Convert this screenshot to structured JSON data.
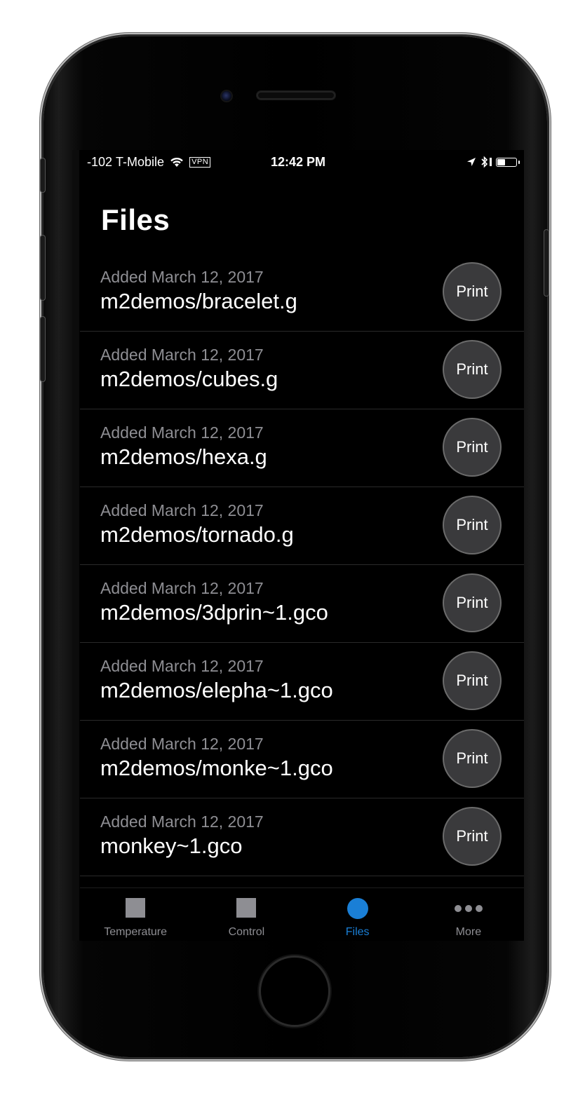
{
  "status_bar": {
    "signal": "-102",
    "carrier": "T-Mobile",
    "vpn": "VPN",
    "time": "12:42 PM",
    "battery_level": 0.45
  },
  "header": {
    "title": "Files"
  },
  "files": [
    {
      "date": "Added March 12, 2017",
      "name": "m2demos/bracelet.g",
      "action": "Print"
    },
    {
      "date": "Added March 12, 2017",
      "name": "m2demos/cubes.g",
      "action": "Print"
    },
    {
      "date": "Added March 12, 2017",
      "name": "m2demos/hexa.g",
      "action": "Print"
    },
    {
      "date": "Added March 12, 2017",
      "name": "m2demos/tornado.g",
      "action": "Print"
    },
    {
      "date": "Added March 12, 2017",
      "name": "m2demos/3dprin~1.gco",
      "action": "Print"
    },
    {
      "date": "Added March 12, 2017",
      "name": "m2demos/elepha~1.gco",
      "action": "Print"
    },
    {
      "date": "Added March 12, 2017",
      "name": "m2demos/monke~1.gco",
      "action": "Print"
    },
    {
      "date": "Added March 12, 2017",
      "name": "monkey~1.gco",
      "action": "Print"
    }
  ],
  "tab_bar": {
    "tabs": [
      {
        "label": "Temperature",
        "icon": "square-icon",
        "active": false
      },
      {
        "label": "Control",
        "icon": "square-icon",
        "active": false
      },
      {
        "label": "Files",
        "icon": "circle-icon",
        "active": true
      },
      {
        "label": "More",
        "icon": "more-dots-icon",
        "active": false
      }
    ]
  },
  "colors": {
    "accent": "#1a7fd6",
    "background": "#000000",
    "secondary_text": "#8e8e93",
    "button_fill": "#3a3a3c"
  }
}
